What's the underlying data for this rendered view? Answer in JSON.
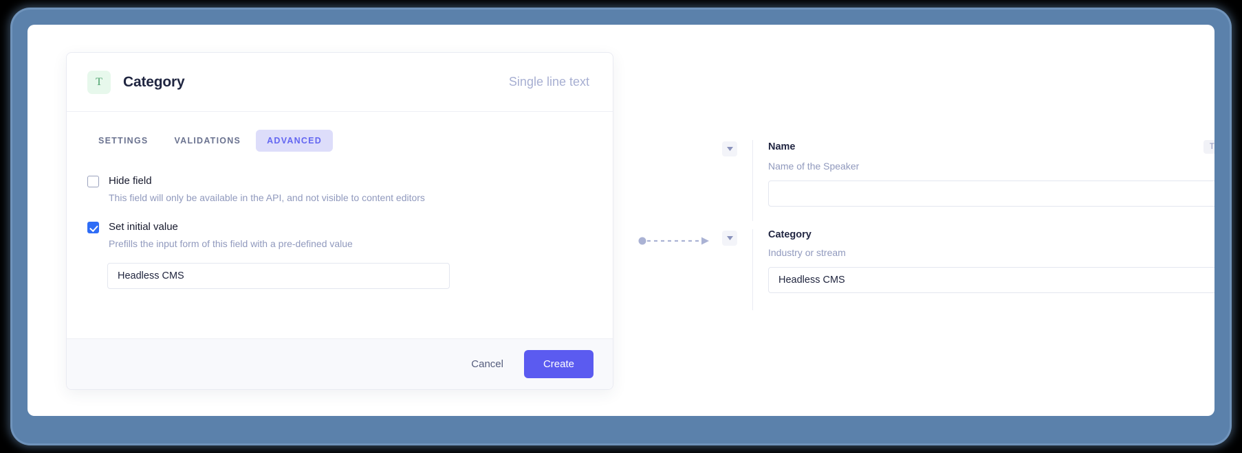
{
  "modal": {
    "header": {
      "type_icon_letter": "T",
      "title": "Category",
      "field_type": "Single line text"
    },
    "tabs": [
      {
        "label": "SETTINGS",
        "active": false
      },
      {
        "label": "VALIDATIONS",
        "active": false
      },
      {
        "label": "ADVANCED",
        "active": true
      }
    ],
    "options": [
      {
        "label": "Hide field",
        "help": "This field will only be available in the API, and not visible to content editors",
        "checked": false
      },
      {
        "label": "Set initial value",
        "help": "Prefills the input form of this field with a pre-defined value",
        "checked": true
      }
    ],
    "initial_value_input": {
      "value": "Headless CMS",
      "placeholder": ""
    },
    "footer": {
      "cancel_label": "Cancel",
      "create_label": "Create"
    }
  },
  "preview": {
    "fields": [
      {
        "label": "Name",
        "subtitle": "Name of the Speaker",
        "badge": "Title",
        "value": "",
        "placeholder": ""
      },
      {
        "label": "Category",
        "subtitle": "Industry or stream",
        "badge": "",
        "value": "Headless CMS",
        "placeholder": ""
      }
    ]
  },
  "colors": {
    "accent": "#5b5bf0",
    "tab_active_bg": "#ddddfa",
    "tab_active_text": "#6366f1",
    "checkbox_checked": "#2f6df6",
    "type_icon_bg": "#e7f8ec",
    "type_icon_text": "#49a06a",
    "frame": "#5b81ab",
    "muted_text": "#9099bd"
  }
}
